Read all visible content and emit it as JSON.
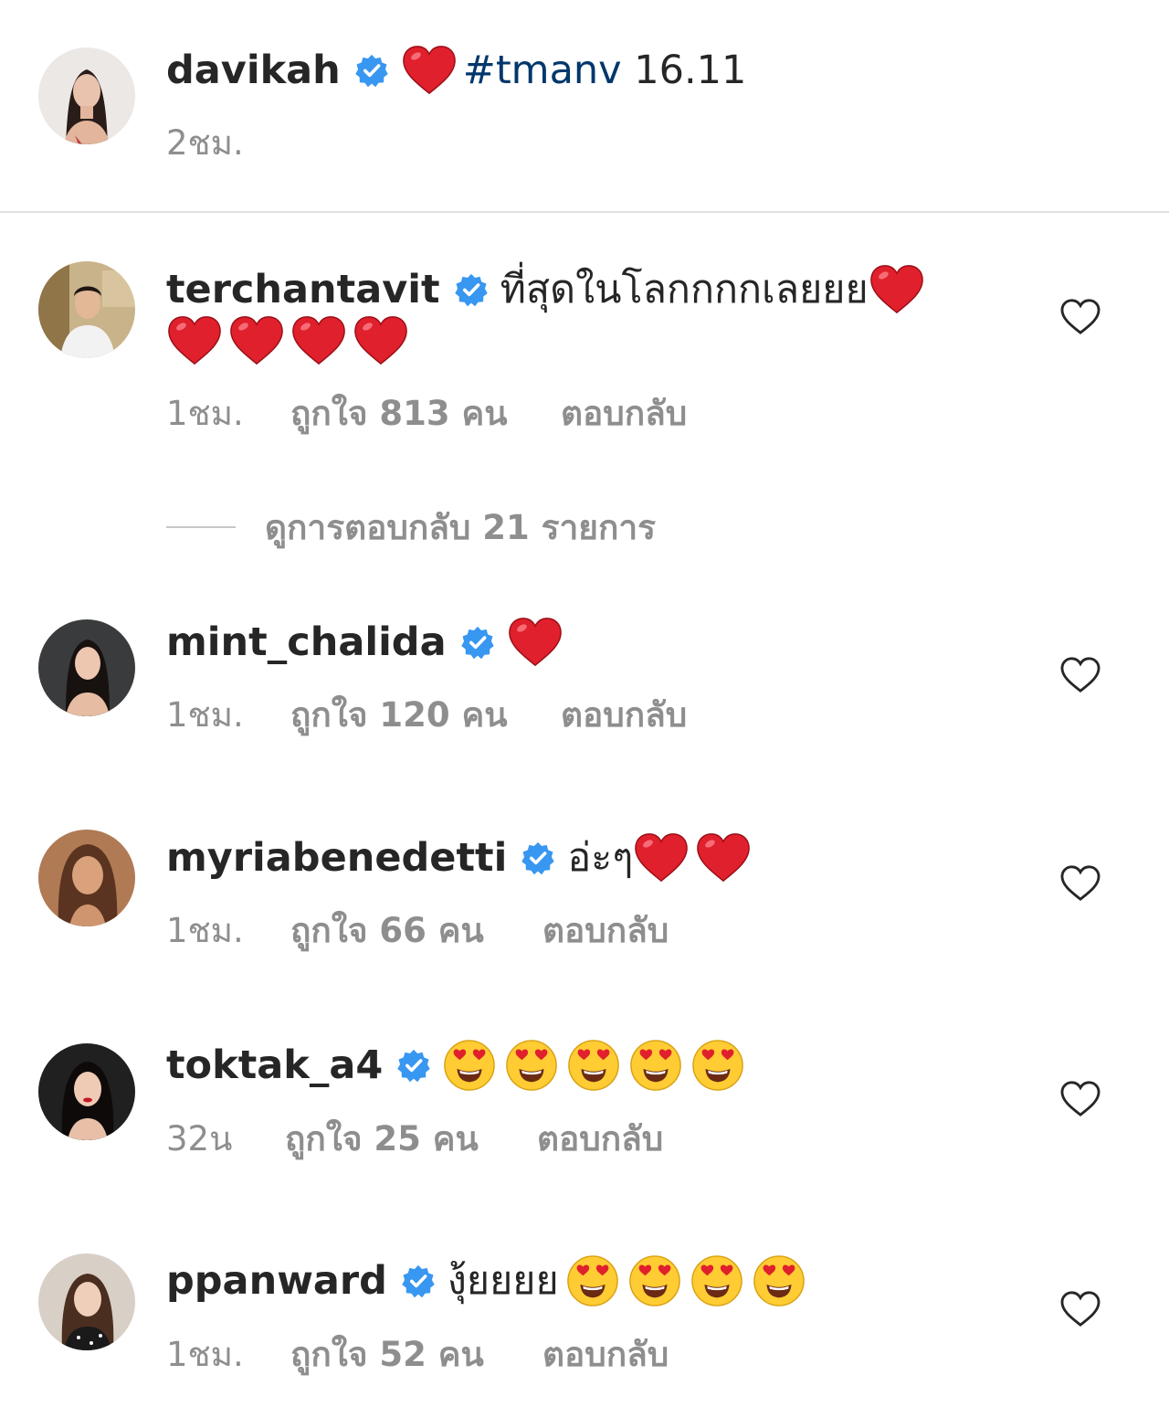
{
  "caption": {
    "username": "davikah",
    "hashtag": "#tmanv",
    "text_after": " 16.11",
    "time": "2ชม."
  },
  "comments": [
    {
      "username": "terchantavit",
      "text": "ที่สุดในโลกกกกเลยยย",
      "time": "1ชม.",
      "likes": "ถูกใจ 813 คน",
      "reply": "ตอบกลับ"
    },
    {
      "username": "mint_chalida",
      "text": "",
      "time": "1ชม.",
      "likes": "ถูกใจ 120 คน",
      "reply": "ตอบกลับ"
    },
    {
      "username": "myriabenedetti",
      "text": "อ่ะๆ",
      "time": "1ชม.",
      "likes": "ถูกใจ 66 คน",
      "reply": "ตอบกลับ"
    },
    {
      "username": "toktak_a4",
      "text": "",
      "time": "32น",
      "likes": "ถูกใจ 25 คน",
      "reply": "ตอบกลับ"
    },
    {
      "username": "ppanward",
      "text": "งุ้ยยยย",
      "time": "1ชม.",
      "likes": "ถูกใจ 52 คน",
      "reply": "ตอบกลับ"
    }
  ],
  "view_replies": "ดูการตอบกลับ 21 รายการ",
  "icons": {
    "verified": "verified-badge-icon",
    "like": "heart-outline-icon",
    "heart_emoji": "red-heart-emoji",
    "heart_eyes_emoji": "heart-eyes-emoji"
  },
  "colors": {
    "username": "#262626",
    "meta": "#8e8e8e",
    "hashtag": "#00376b",
    "verified": "#3897f0",
    "heart": "#e0202c"
  }
}
